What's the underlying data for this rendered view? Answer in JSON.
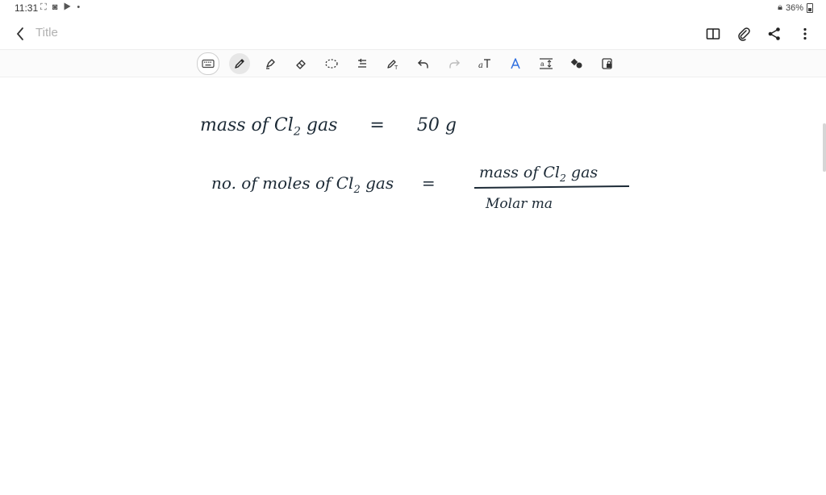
{
  "status": {
    "time": "11:31",
    "battery": "36%"
  },
  "header": {
    "title": "Title"
  },
  "toolbar": {
    "tools": [
      "keyboard-icon",
      "pen-icon",
      "highlighter-icon",
      "eraser-icon",
      "lasso-icon",
      "text-align-icon",
      "pen-settings-icon",
      "undo-icon",
      "redo-icon",
      "text-tool-icon",
      "shape-icon",
      "text-format-icon",
      "shapes-icon",
      "lock-icon"
    ]
  },
  "note": {
    "line1": {
      "lhs": "mass of Cl",
      "sub": "2",
      "rhs_label": " gas",
      "eq": "=",
      "value": "50 g"
    },
    "line2": {
      "lhs": "no. of moles of Cl",
      "sub": "2",
      "rhs_label": " gas",
      "eq": "="
    },
    "fraction": {
      "numerator": "mass of Cl",
      "num_sub": "2",
      "num_tail": " gas",
      "denominator": "Molar ma"
    }
  }
}
